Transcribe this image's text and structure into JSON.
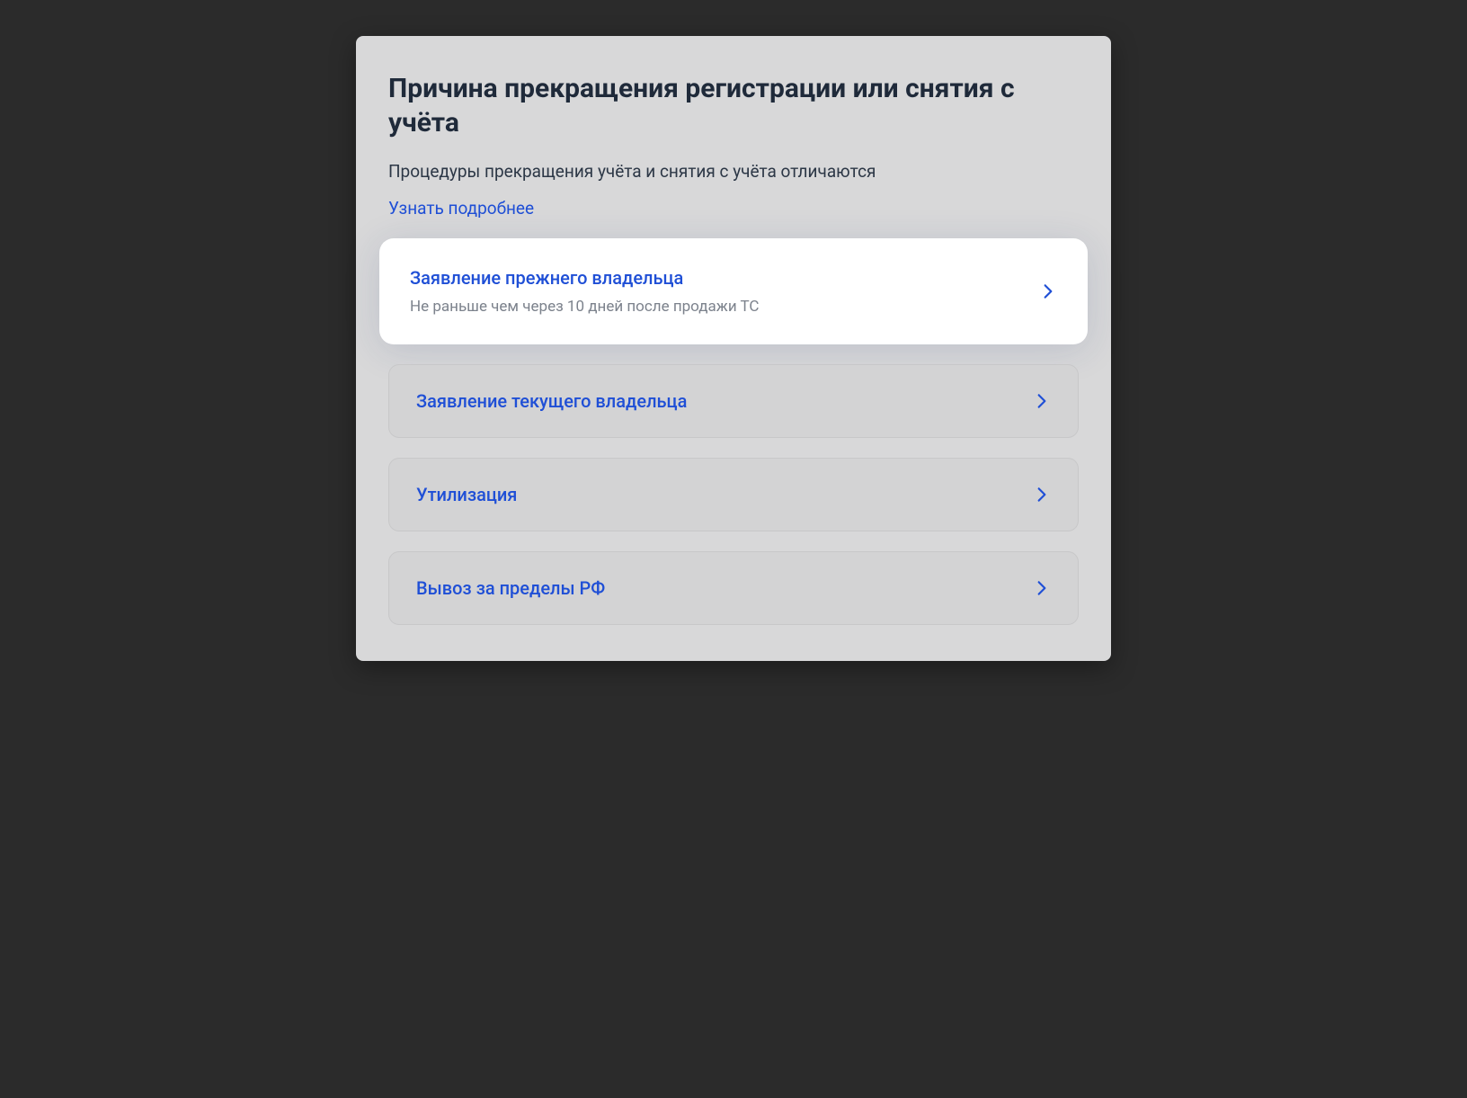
{
  "header": {
    "title": "Причина прекращения регистрации или снятия с учёта",
    "subtitle": "Процедуры прекращения учёта и снятия с учёта отличаются",
    "learn_more": "Узнать подробнее"
  },
  "options": {
    "0": {
      "label": "Заявление прежнего владельца",
      "desc": "Не раньше чем через 10 дней после продажи ТС"
    },
    "1": {
      "label": "Заявление текущего владельца"
    },
    "2": {
      "label": "Утилизация"
    },
    "3": {
      "label": "Вывоз за пределы РФ"
    }
  },
  "colors": {
    "accent": "#1f4fd6"
  }
}
